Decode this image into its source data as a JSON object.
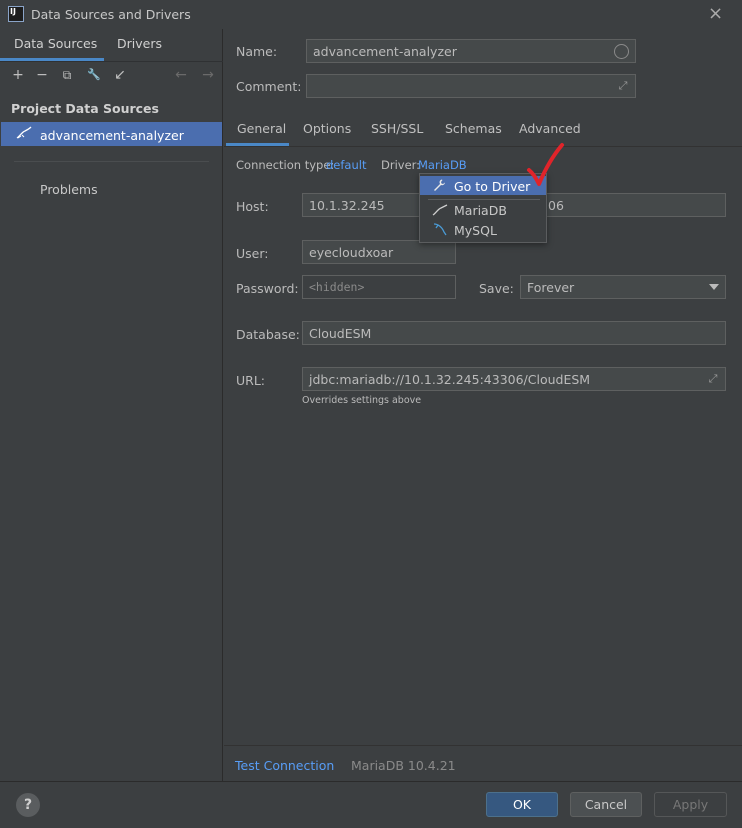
{
  "window": {
    "title": "Data Sources and Drivers",
    "close_glyph": "×"
  },
  "left": {
    "tabs": [
      {
        "label": "Data Sources"
      },
      {
        "label": "Drivers"
      }
    ],
    "toolbar": [
      {
        "name": "add-icon",
        "glyph": "+"
      },
      {
        "name": "remove-icon",
        "glyph": "−"
      },
      {
        "name": "duplicate-icon",
        "glyph": "⧉"
      },
      {
        "name": "wrench-icon",
        "glyph": "🔧"
      },
      {
        "name": "import-icon",
        "glyph": "↙"
      },
      {
        "name": "back-arrow-icon",
        "glyph": "←"
      },
      {
        "name": "forward-arrow-icon",
        "glyph": "→"
      }
    ],
    "section_title": "Project Data Sources",
    "data_sources": [
      {
        "label": "advancement-analyzer"
      }
    ],
    "problems_label": "Problems"
  },
  "form": {
    "name_label": "Name:",
    "name_value": "advancement-analyzer",
    "comment_label": "Comment:",
    "comment_value": "",
    "tabs": [
      {
        "label": "General"
      },
      {
        "label": "Options"
      },
      {
        "label": "SSH/SSL"
      },
      {
        "label": "Schemas"
      },
      {
        "label": "Advanced"
      }
    ],
    "connection_type_label": "Connection type:",
    "connection_type_value": "default",
    "driver_label": "Driver:",
    "driver_value": "MariaDB",
    "host_label": "Host:",
    "host_value": "10.1.32.245",
    "port_value_fragment": "06",
    "user_label": "User:",
    "user_value": "eyecloudxoar",
    "password_label": "Password:",
    "password_placeholder": "<hidden>",
    "save_label": "Save:",
    "save_value": "Forever",
    "database_label": "Database:",
    "database_value": "CloudESM",
    "url_label": "URL:",
    "url_value": "jdbc:mariadb://10.1.32.245:43306/CloudESM",
    "url_note": "Overrides settings above"
  },
  "driver_popup": {
    "items": [
      {
        "label": "Go to Driver",
        "icon": "wrench-icon"
      },
      {
        "label": "MariaDB",
        "icon": "mariadb-icon"
      },
      {
        "label": "MySQL",
        "icon": "mysql-dolphin-icon"
      }
    ]
  },
  "footer": {
    "test_connection": "Test Connection",
    "server_version": "MariaDB 10.4.21",
    "help": "?",
    "ok": "OK",
    "cancel": "Cancel",
    "apply": "Apply"
  },
  "colors": {
    "background": "#3c3f41",
    "selection": "#4b6eaf",
    "link": "#589df6",
    "accent_underline": "#4a88c7",
    "primary_button": "#365880",
    "annotation_red": "#e0242a"
  }
}
